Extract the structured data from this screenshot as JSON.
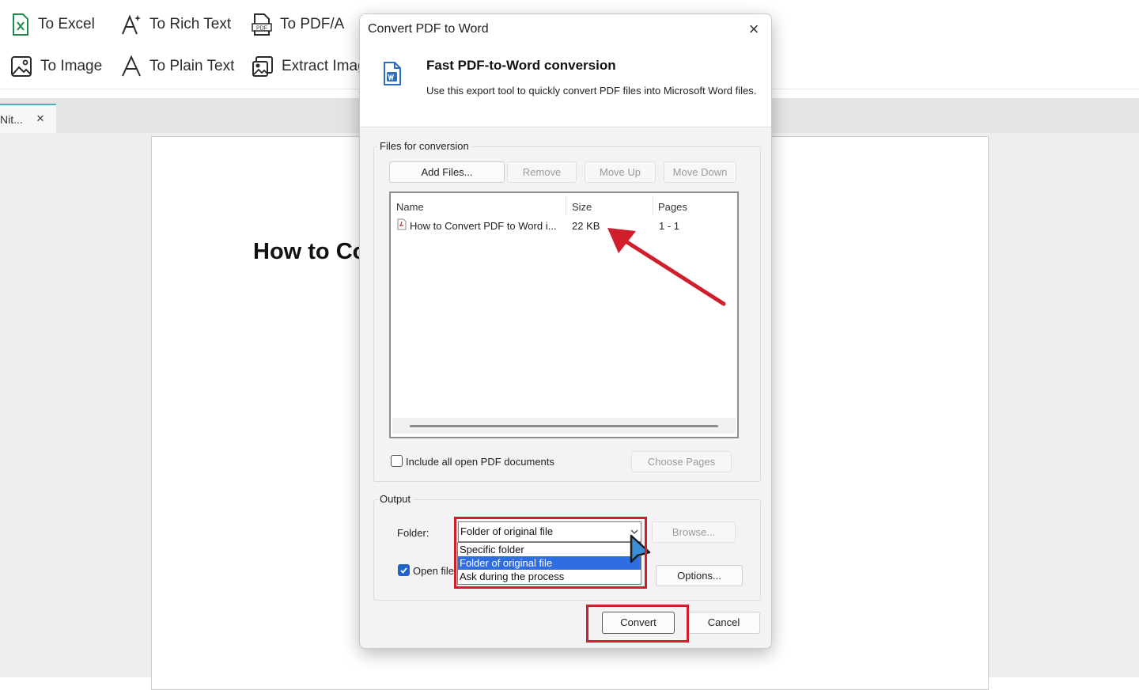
{
  "ribbon": {
    "to_excel": "To Excel",
    "to_rich_text": "To Rich Text",
    "to_pdfa": "To PDF/A",
    "to_image": "To Image",
    "to_plain_text": "To Plain Text",
    "extract_images": "Extract Imag"
  },
  "tab": {
    "label": "Nit...",
    "close": "×"
  },
  "document": {
    "heading": "How to Co"
  },
  "dialog": {
    "title": "Convert PDF to Word",
    "close": "×",
    "heading": "Fast PDF-to-Word conversion",
    "description": "Use this export tool to quickly convert PDF files into Microsoft Word files.",
    "files": {
      "label": "Files for conversion",
      "add_files": "Add Files...",
      "remove": "Remove",
      "move_up": "Move Up",
      "move_down": "Move Down",
      "columns": {
        "name": "Name",
        "size": "Size",
        "pages": "Pages"
      },
      "rows": [
        {
          "name": "How to Convert PDF to Word i...",
          "size": "22 KB",
          "pages": "1 - 1"
        }
      ],
      "include_all": "Include all open PDF documents",
      "choose_pages": "Choose Pages"
    },
    "output": {
      "label": "Output",
      "folder_label": "Folder:",
      "folder_value": "Folder of original file",
      "options": [
        "Specific folder",
        "Folder of original file",
        "Ask during the process"
      ],
      "browse": "Browse...",
      "open_file_label": "Open file",
      "options_button": "Options..."
    },
    "convert": "Convert",
    "cancel": "Cancel"
  },
  "colors": {
    "excel_green": "#1f8a4c",
    "word_blue": "#2b6cc4",
    "highlight_red": "#d11e2d",
    "selection_blue": "#2e6ee0",
    "tab_accent": "#4cb3b3"
  }
}
